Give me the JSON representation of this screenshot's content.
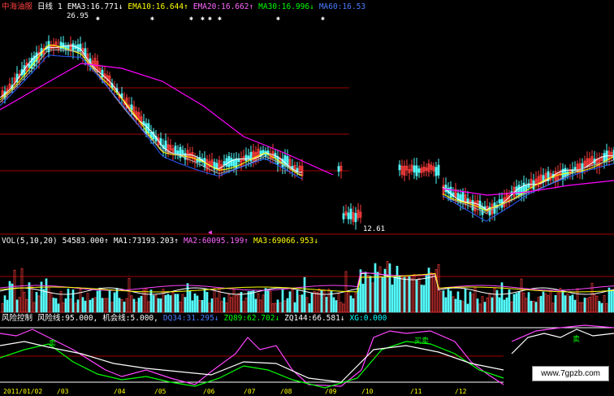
{
  "top_bar": {
    "stock_name": "中海油服",
    "period": "日线",
    "index": "1",
    "ema3_label": "EMA3:",
    "ema3_value": "16.771↓",
    "ema10_label": "EMA10:",
    "ema10_value": "16.644↑",
    "ema20_label": "EMA20:",
    "ema20_value": "16.662↑",
    "ma30_label": "MA30:",
    "ma30_value": "16.996↓",
    "ma60_label": "MA60:",
    "ma60_value": "16.53"
  },
  "price_marks": {
    "high": "26.95",
    "low": "12.61"
  },
  "vol_bar": {
    "label": "VOL(5,10,20)",
    "vol_value": "54583.000↑",
    "ma1_label": "MA1:",
    "ma1_value": "73193.203↑",
    "ma2_label": "MA2:",
    "ma2_value": "60095.199↑",
    "ma3_label": "MA3:",
    "ma3_value": "69066.953↓"
  },
  "risk_bar": {
    "label": "风险控制",
    "risk_line_label": "风险线:",
    "risk_line_value": "95.000,",
    "chance_label": "机会线:",
    "chance_value": "5.000,",
    "dq34_label": "DQ34:",
    "dq34_value": "31.295↓",
    "zq89_label": "ZQ89:",
    "zq89_value": "62.702↓",
    "zq144_label": "ZQ144:",
    "zq144_value": "66.581↓",
    "xg_label": "XG:",
    "xg_value": "0.000"
  },
  "signals": {
    "sell": "卖",
    "buy_sell": "买卖"
  },
  "watermark": "www.7gpzb.com",
  "x_axis": [
    "2011/01/02",
    "/03",
    "/04",
    "/05",
    "/06",
    "/07",
    "/08",
    "/09",
    "/10",
    "/11",
    "/12"
  ],
  "colors": {
    "background": "#000000",
    "up_candle": "#ff3c3c",
    "down_candle": "#54fcfc",
    "ema3": "#ffffff",
    "ema10": "#ffff00",
    "ema20": "#ff00ff",
    "ma30": "#00ff00",
    "ma60": "#2a5cff",
    "grid": "#a00000",
    "dq": "#ffffff",
    "zq89": "#ffff00",
    "zq144": "#ff00ff"
  }
}
